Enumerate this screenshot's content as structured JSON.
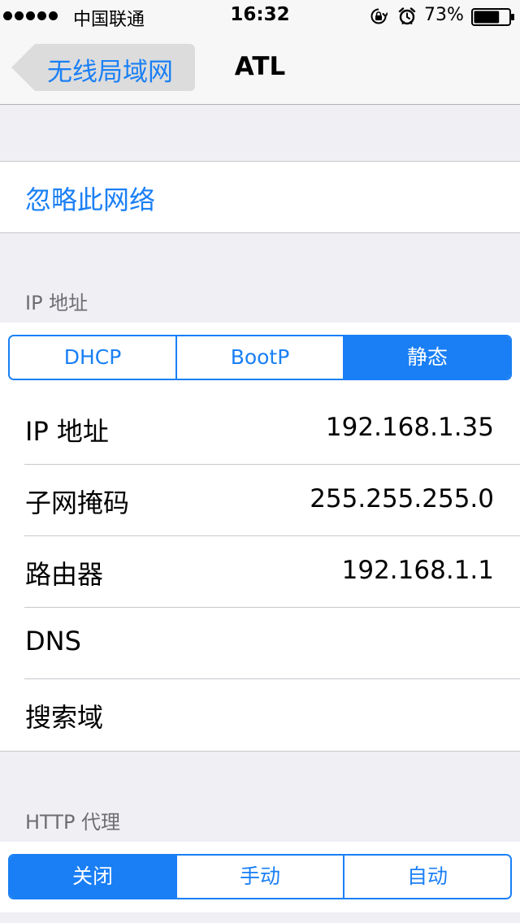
{
  "status_bar": {
    "carrier": "中国联通",
    "time": "16:32",
    "battery_percent": "73%",
    "battery_level": 0.73,
    "signal_bars": 5,
    "icons": [
      "signal-dots-icon",
      "rotation-lock-icon",
      "alarm-icon",
      "battery-icon"
    ]
  },
  "nav": {
    "back_label": "无线局域网",
    "title": "ATL"
  },
  "forget": {
    "label": "忽略此网络"
  },
  "ip_section": {
    "header": "IP 地址",
    "modes": [
      {
        "label": "DHCP",
        "selected": false
      },
      {
        "label": "BootP",
        "selected": false
      },
      {
        "label": "静态",
        "selected": true
      }
    ],
    "rows": [
      {
        "label": "IP 地址",
        "value": "192.168.1.35"
      },
      {
        "label": "子网掩码",
        "value": "255.255.255.0"
      },
      {
        "label": "路由器",
        "value": "192.168.1.1"
      },
      {
        "label": "DNS",
        "value": ""
      },
      {
        "label": "搜索域",
        "value": ""
      }
    ]
  },
  "proxy_section": {
    "header": "HTTP 代理",
    "modes": [
      {
        "label": "关闭",
        "selected": true
      },
      {
        "label": "手动",
        "selected": false
      },
      {
        "label": "自动",
        "selected": false
      }
    ]
  },
  "colors": {
    "accent": "#1a7ff5",
    "background": "#efeff4",
    "separator": "#c8c7cc"
  }
}
